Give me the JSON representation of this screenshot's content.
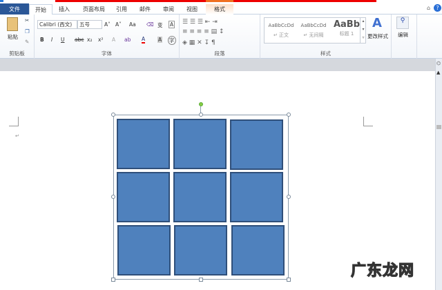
{
  "tabs": [
    "文件",
    "开始",
    "插入",
    "页面布局",
    "引用",
    "邮件",
    "审阅",
    "视图",
    "格式"
  ],
  "clipboard": {
    "paste": "粘贴",
    "label": "剪贴板"
  },
  "font": {
    "name": "Calibri (西文)",
    "size": "五号",
    "label": "字体",
    "bold": "B",
    "italic": "I",
    "underline": "U",
    "strike": "abc",
    "sub": "x₂",
    "sup": "x²",
    "case": "Aa",
    "grow": "A˄",
    "shrink": "A˅",
    "color_a": "A",
    "highlight": "ab",
    "phonetic": "变",
    "border_a": "A",
    "circle": "字"
  },
  "paragraph": {
    "label": "段落"
  },
  "styles": {
    "label": "样式",
    "items": [
      {
        "preview": "AaBbCcDd",
        "name": "↵ 正文"
      },
      {
        "preview": "AaBbCcDd",
        "name": "↵ 无间隔"
      },
      {
        "preview": "AaBb",
        "name": "标题 1"
      }
    ],
    "change": "更改样式"
  },
  "editing": {
    "label": "编辑"
  },
  "watermark": "广东龙网",
  "colors": {
    "shape_fill": "#4f81bd",
    "shape_border": "#2f4f7a",
    "file_tab": "#2b5797"
  }
}
